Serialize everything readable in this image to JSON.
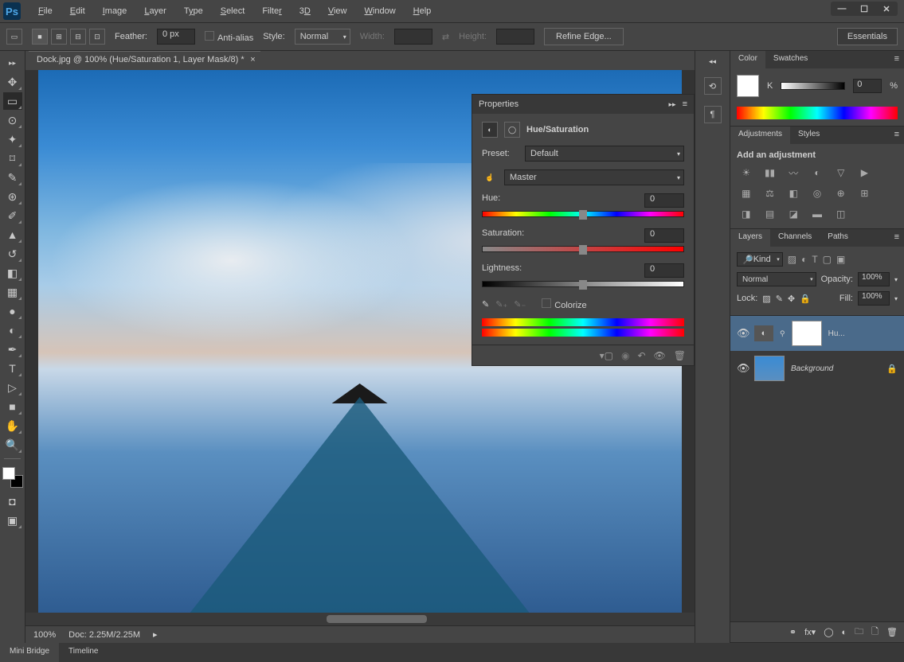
{
  "app": {
    "name": "Ps"
  },
  "menus": [
    "File",
    "Edit",
    "Image",
    "Layer",
    "Type",
    "Select",
    "Filter",
    "3D",
    "View",
    "Window",
    "Help"
  ],
  "optionsBar": {
    "feather_label": "Feather:",
    "feather_value": "0 px",
    "antialias_label": "Anti-alias",
    "style_label": "Style:",
    "style_value": "Normal",
    "width_label": "Width:",
    "height_label": "Height:",
    "refine_edge": "Refine Edge...",
    "workspace_preset": "Essentials"
  },
  "document": {
    "tab_title": "Dock.jpg @ 100% (Hue/Saturation 1, Layer Mask/8) *",
    "zoom": "100%",
    "doc_info": "Doc: 2.25M/2.25M"
  },
  "bottomTabs": [
    "Mini Bridge",
    "Timeline"
  ],
  "propertiesPanel": {
    "title": "Properties",
    "adjustment_name": "Hue/Saturation",
    "preset_label": "Preset:",
    "preset_value": "Default",
    "channel_value": "Master",
    "hue_label": "Hue:",
    "hue_value": "0",
    "sat_label": "Saturation:",
    "sat_value": "0",
    "light_label": "Lightness:",
    "light_value": "0",
    "colorize_label": "Colorize"
  },
  "colorPanel": {
    "tabs": [
      "Color",
      "Swatches"
    ],
    "k_label": "K",
    "k_value": "0",
    "percent": "%"
  },
  "adjustmentsPanel": {
    "tabs": [
      "Adjustments",
      "Styles"
    ],
    "heading": "Add an adjustment"
  },
  "layersPanel": {
    "tabs": [
      "Layers",
      "Channels",
      "Paths"
    ],
    "filter_kind": "Kind",
    "blend_mode": "Normal",
    "opacity_label": "Opacity:",
    "opacity_value": "100%",
    "lock_label": "Lock:",
    "fill_label": "Fill:",
    "fill_value": "100%",
    "layers": [
      {
        "name": "Hu...",
        "type": "adjustment",
        "locked": false
      },
      {
        "name": "Background",
        "type": "image",
        "locked": true
      }
    ]
  }
}
